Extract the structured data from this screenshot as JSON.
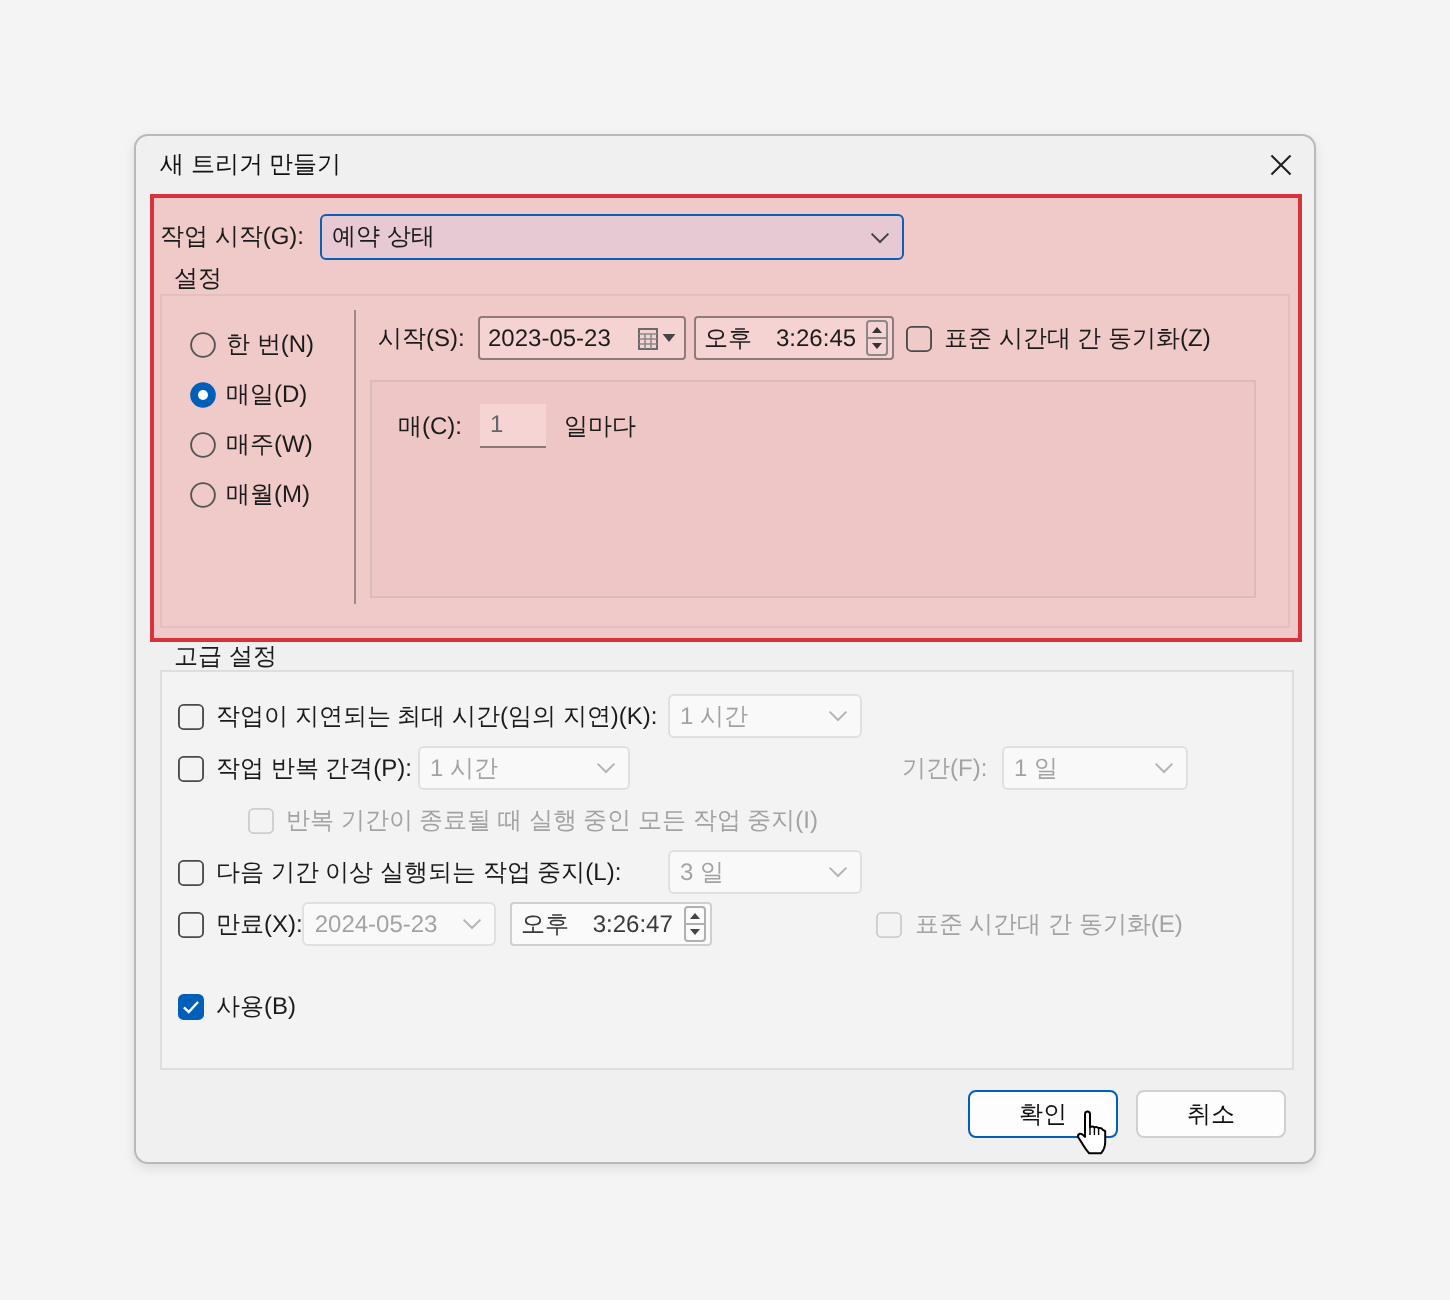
{
  "dialog": {
    "title": "새 트리거 만들기"
  },
  "begin_task": {
    "label": "작업 시작(G):",
    "value": "예약 상태",
    "focused": true
  },
  "settings": {
    "title": "설정",
    "schedule_options": [
      {
        "label": "한 번(N)",
        "selected": false
      },
      {
        "label": "매일(D)",
        "selected": true
      },
      {
        "label": "매주(W)",
        "selected": false
      },
      {
        "label": "매월(M)",
        "selected": false
      }
    ],
    "start": {
      "label": "시작(S):",
      "date": "2023-05-23",
      "period": "오후",
      "time": "3:26:45"
    },
    "sync_timezone": {
      "label": "표준 시간대 간 동기화(Z)",
      "checked": false,
      "disabled": false
    },
    "recur": {
      "label": "매(C):",
      "value": "1",
      "unit": "일마다"
    }
  },
  "advanced": {
    "title": "고급 설정",
    "rows": [
      {
        "kind": "check_combo",
        "label": "작업이 지연되는 최대 시간(임의 지연)(K):",
        "checked": false,
        "disabled": false,
        "combo": {
          "value": "1 시간",
          "disabled": true
        }
      },
      {
        "kind": "repeat",
        "label": "작업 반복 간격(P):",
        "checked": false,
        "disabled": false,
        "combo": {
          "value": "1 시간",
          "disabled": true
        },
        "duration": {
          "label": "기간(F):",
          "value": "1 일",
          "disabled": true
        }
      },
      {
        "kind": "sub_check",
        "label": "반복 기간이 종료될 때 실행 중인 모든 작업 중지(I)",
        "checked": false,
        "disabled": true
      },
      {
        "kind": "check_combo",
        "label": "다음 기간 이상 실행되는 작업 중지(L):",
        "checked": false,
        "disabled": false,
        "combo": {
          "value": "3 일",
          "disabled": true
        }
      },
      {
        "kind": "expire",
        "label": "만료(X):",
        "checked": false,
        "disabled": false,
        "date": {
          "value": "2024-05-23",
          "disabled": true
        },
        "time": {
          "period": "오후",
          "value": "3:26:47",
          "disabled": false
        },
        "sync": {
          "label": "표준 시간대 간 동기화(E)",
          "checked": false,
          "disabled": true
        }
      },
      {
        "kind": "enabled",
        "label": "사용(B)",
        "checked": true,
        "disabled": false
      }
    ]
  },
  "buttons": [
    {
      "label": "확인",
      "default": true
    },
    {
      "label": "취소",
      "default": false
    }
  ]
}
